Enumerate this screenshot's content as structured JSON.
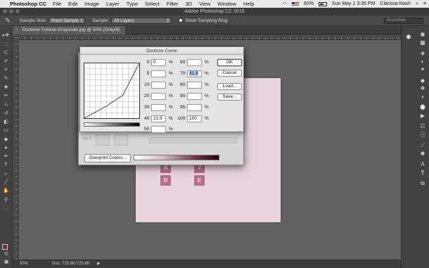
{
  "menubar": {
    "apple": "",
    "app": "Photoshop CC",
    "items": [
      "File",
      "Edit",
      "Image",
      "Layer",
      "Type",
      "Select",
      "Filter",
      "3D",
      "View",
      "Window",
      "Help"
    ],
    "battery": "60%",
    "datetime": "Sun May 1  3:35 PM",
    "user": "Clarissa Nash"
  },
  "window": {
    "title": "Adobe Photoshop CC 2015"
  },
  "options": {
    "sample_size_label": "Sample Size:",
    "sample_size_value": "Point Sample",
    "sample_label": "Sample:",
    "sample_value": "All Layers",
    "show_ring_label": "Show Sampling Ring",
    "workspace": "Essentials"
  },
  "document": {
    "tab": "Duotone Tutorial-Grayscale.jpg @ 50% (Gray/8)",
    "tiles": [
      "N",
      "V",
      "D",
      "E"
    ]
  },
  "status": {
    "zoom": "50%",
    "doc": "Doc: 725.8K/725.8K"
  },
  "curve_dialog": {
    "title": "Duotone Curve",
    "fields_left": [
      {
        "label": "0:",
        "value": "0"
      },
      {
        "label": "5:",
        "value": ""
      },
      {
        "label": "10:",
        "value": ""
      },
      {
        "label": "20:",
        "value": ""
      },
      {
        "label": "30:",
        "value": ""
      },
      {
        "label": "40:",
        "value": "21.9"
      },
      {
        "label": "50:",
        "value": ""
      }
    ],
    "fields_right": [
      {
        "label": "60:",
        "value": ""
      },
      {
        "label": "70:",
        "value": "41.9"
      },
      {
        "label": "80:",
        "value": ""
      },
      {
        "label": "90:",
        "value": ""
      },
      {
        "label": "95:",
        "value": ""
      },
      {
        "label": "100:",
        "value": "100"
      }
    ],
    "pct": "%",
    "buttons": {
      "ok": "OK",
      "cancel": "Cancel",
      "load": "Load...",
      "save": "Save..."
    }
  },
  "options_dialog": {
    "ink4_label": "Ink 4:",
    "overprint": "Overprint Colors..."
  }
}
